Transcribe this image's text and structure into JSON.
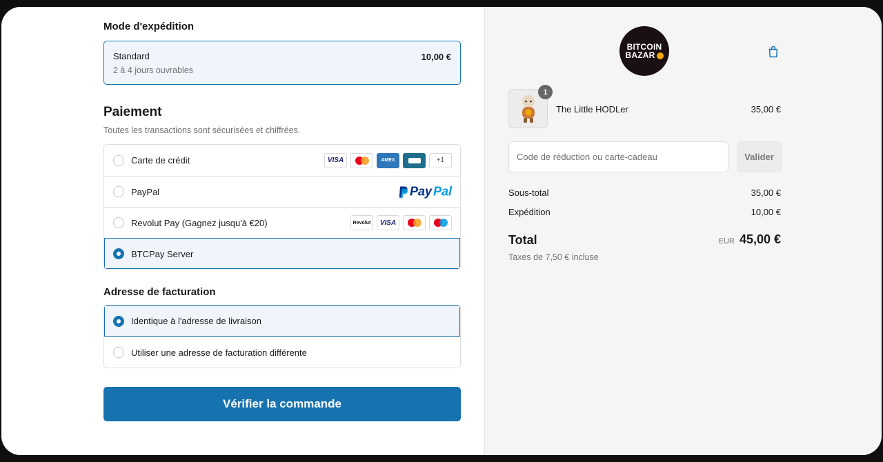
{
  "shipping": {
    "heading": "Mode d'expédition",
    "method_name": "Standard",
    "method_sub": "2 à 4 jours ouvrables",
    "method_price": "10,00 €"
  },
  "payment": {
    "heading": "Paiement",
    "subheading": "Toutes les transactions sont sécurisées et chiffrées.",
    "options": [
      {
        "label": "Carte de crédit",
        "selected": false
      },
      {
        "label": "PayPal",
        "selected": false
      },
      {
        "label": "Revolut Pay (Gagnez jusqu'à €20)",
        "selected": false
      },
      {
        "label": "BTCPay Server",
        "selected": true
      }
    ],
    "card_brands": [
      "VISA",
      "AMEX",
      "+1"
    ],
    "paypal_logo": {
      "p1": "Pay",
      "p2": "Pal"
    },
    "revolut_brands": [
      "Revolut",
      "VISA"
    ]
  },
  "billing": {
    "heading": "Adresse de facturation",
    "options": [
      {
        "label": "Identique à l'adresse de livraison",
        "selected": true
      },
      {
        "label": "Utiliser une adresse de facturation différente",
        "selected": false
      }
    ]
  },
  "submit_label": "Vérifier la commande",
  "summary": {
    "logo_line1": "BITCOIN",
    "logo_line2": "BAZAR",
    "product": {
      "name": "The Little HODLer",
      "price": "35,00 €",
      "quantity": "1"
    },
    "discount_placeholder": "Code de réduction ou carte-cadeau",
    "apply_label": "Valider",
    "subtotal_label": "Sous-total",
    "subtotal_value": "35,00 €",
    "shipping_label": "Expédition",
    "shipping_value": "10,00 €",
    "total_label": "Total",
    "currency": "EUR",
    "total_value": "45,00 €",
    "tax_note": "Taxes de 7,50 € incluse"
  },
  "colors": {
    "accent": "#1773b0",
    "selected_bg": "#f0f5fb",
    "summary_bg": "#f5f5f5"
  }
}
